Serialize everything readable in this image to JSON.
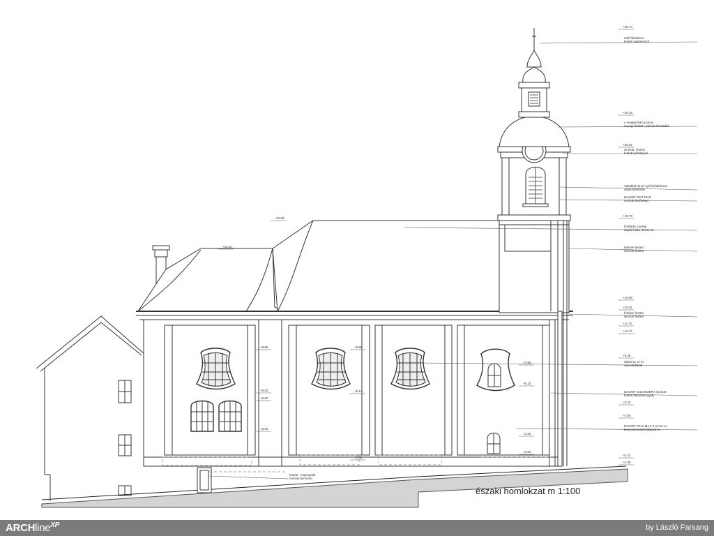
{
  "caption": "északi homlokzat m 1:100",
  "footer": {
    "logo_main": "ARCH",
    "logo_light": "line",
    "logo_sup": "XP",
    "credit": "by László Farsang"
  },
  "elevations": [
    {
      "label": "+36.77"
    },
    {
      "label": "+29.19"
    },
    {
      "label": "+26.61"
    },
    {
      "label": "+20.79"
    },
    {
      "label": "+20.59"
    },
    {
      "label": "+18.10"
    },
    {
      "label": "+15.99"
    },
    {
      "label": "+15.01"
    },
    {
      "label": "+11.75"
    },
    {
      "label": "+11.17"
    },
    {
      "label": "+9.69"
    },
    {
      "label": "+9.69"
    },
    {
      "label": "+9.05"
    },
    {
      "label": "+7.95"
    },
    {
      "label": "+6.14"
    },
    {
      "label": "+6.20"
    },
    {
      "label": "+5.60"
    },
    {
      "label": "+6.10"
    },
    {
      "label": "+5.20"
    },
    {
      "label": "+4.00"
    },
    {
      "label": "+3.00"
    },
    {
      "label": "+2.30"
    },
    {
      "label": "+0.60"
    },
    {
      "label": "+0.50"
    },
    {
      "label": "+0.74"
    },
    {
      "label": "+0.08"
    }
  ],
  "annotations": [
    {
      "lines": [
        "mall fakalárna",
        "festett vakkeresztt"
      ]
    },
    {
      "lines": [
        "a meglevővel azonos",
        "anyagú fedett - párnás fémfedés"
      ]
    },
    {
      "lines": [
        "simított, festett,",
        "festett párkányok"
      ]
    },
    {
      "lines": [
        "Vakablak (6,5) nyúl kéttárbaras",
        "ablak kifestése"
      ]
    },
    {
      "lines": [
        "BAUMIT SMT MAS",
        "simított fedőréteg"
      ]
    },
    {
      "lines": [
        "hódfarkú cserép",
        "dupla fedés fekete sz."
      ]
    },
    {
      "lines": [
        "fehérre festett",
        "simított festett"
      ]
    },
    {
      "lines": [
        "fehérre festett",
        "simított festett"
      ]
    },
    {
      "lines": [
        "dúbarna, to és",
        "szemöldökök"
      ]
    },
    {
      "lines": [
        "BAUMIT SUD EMERA simított",
        "festett lábazatszegély"
      ]
    },
    {
      "lines": [
        "BAUMIT 2Kx3 MAS 0,4 mm-es",
        "kavicsszórtatolt lábazat fe."
      ]
    },
    {
      "lines": [
        "festett - impregnált",
        "homlokzati keret"
      ]
    }
  ]
}
